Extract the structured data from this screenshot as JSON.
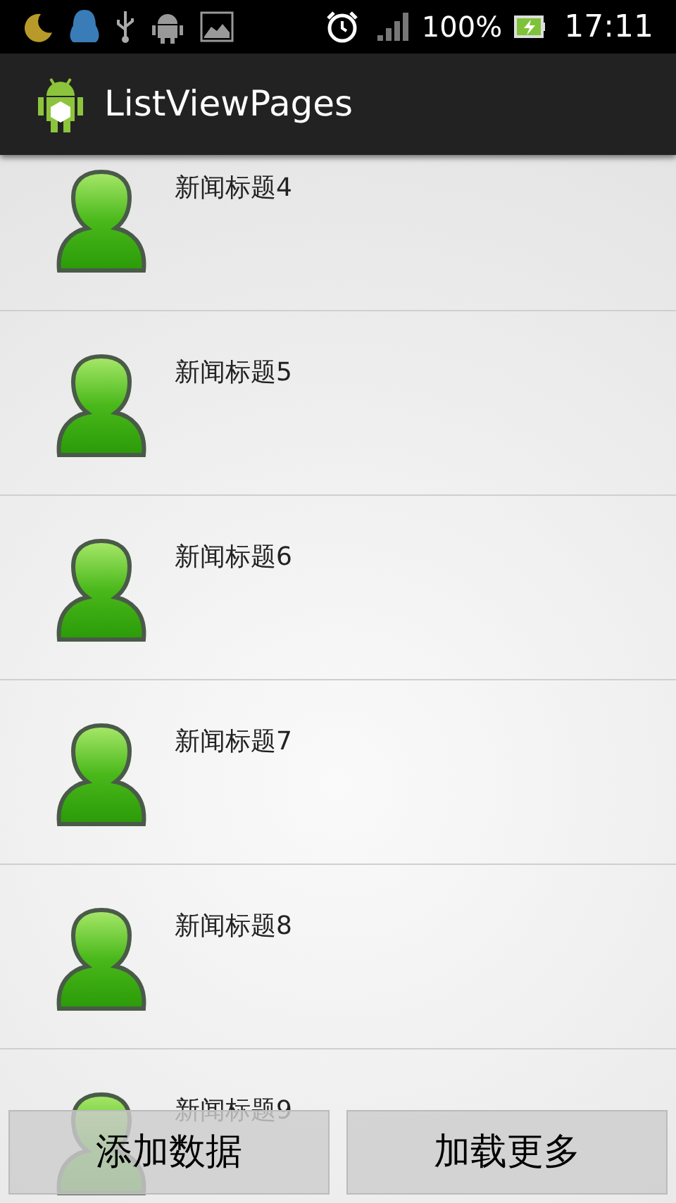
{
  "status_bar": {
    "battery": "100%",
    "time": "17:11"
  },
  "action_bar": {
    "title": "ListViewPages"
  },
  "list": {
    "items": [
      {
        "title": "新闻标题4"
      },
      {
        "title": "新闻标题5"
      },
      {
        "title": "新闻标题6"
      },
      {
        "title": "新闻标题7"
      },
      {
        "title": "新闻标题8"
      },
      {
        "title": "新闻标题9"
      }
    ]
  },
  "buttons": [
    {
      "label": "添加数据"
    },
    {
      "label": "加载更多"
    }
  ]
}
